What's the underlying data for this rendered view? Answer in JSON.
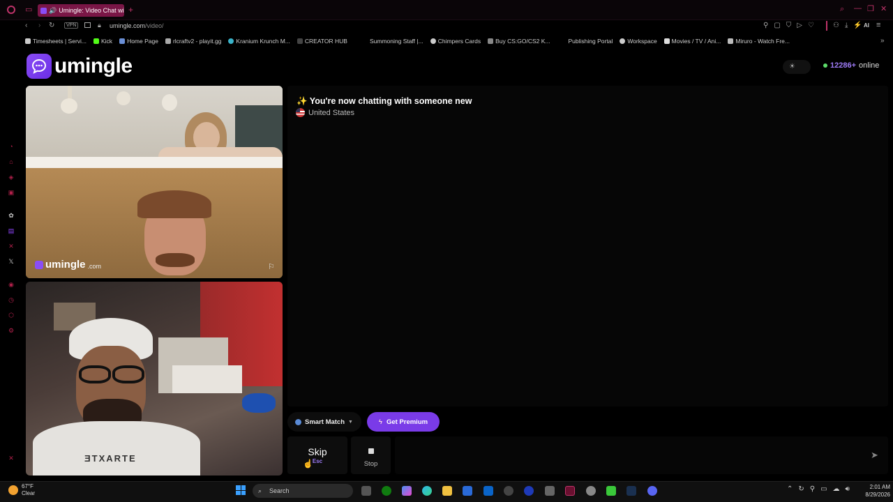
{
  "browser": {
    "tab_title": "Umingle: Video Chat wi",
    "url_host": "umingle.com",
    "url_path": "/video/",
    "vpn": "VPN",
    "ai": "AI",
    "bookmarks": [
      "Timesheets | Servi...",
      "Kick",
      "Home Page",
      "rlcraftv2 - playit.gg",
      "Kranium Krunch M...",
      "CREATOR HUB",
      "Summoning Staff |...",
      "Chimpers Cards",
      "Buy CS:GO/CS2 K...",
      "Publishing Portal",
      "Workspace",
      "Movies / TV / Ani...",
      "Miruro - Watch Fre..."
    ]
  },
  "site": {
    "logo": "umingle",
    "online_count": "12286+",
    "online_label": "online",
    "watermark": "umingle",
    "watermark_tld": ".com",
    "chat_message": "✨ You're now chatting with someone new",
    "country": "United States",
    "smart_match": "Smart Match",
    "premium": "Get Premium",
    "skip": "Skip",
    "skip_key": "Esc",
    "stop": "Stop"
  },
  "taskbar": {
    "temp": "67°F",
    "weather": "Clear",
    "search": "Search",
    "time": "2:01 AM",
    "date": "8/29/2026"
  },
  "colors": {
    "accent": "#7a3be8",
    "brand_red": "#b0204a"
  }
}
